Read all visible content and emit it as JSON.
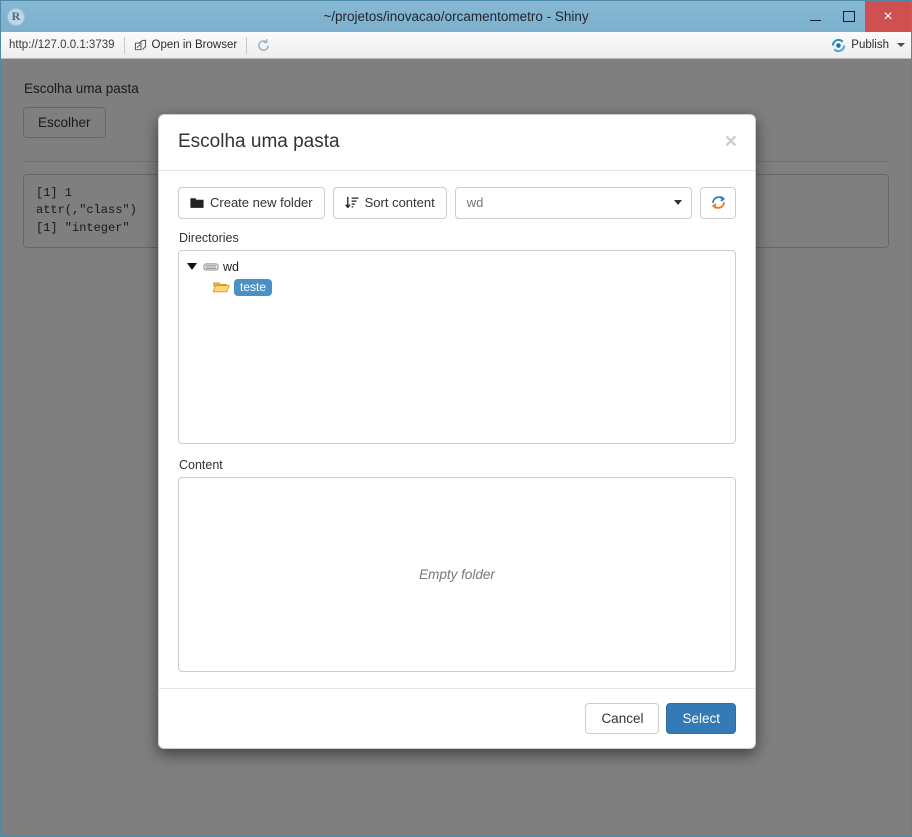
{
  "window": {
    "app_icon_letter": "R",
    "title": "~/projetos/inovacao/orcamentometro - Shiny",
    "minimize_label": "Minimize",
    "maximize_label": "Maximize",
    "close_label": "×"
  },
  "viewer_toolbar": {
    "url": "http://127.0.0.1:3739",
    "open_in_browser": "Open in Browser",
    "refresh_title": "Refresh",
    "publish": "Publish"
  },
  "app": {
    "field_label": "Escolha uma pasta",
    "choose_button": "Escolher",
    "code_output": "[1] 1\nattr(,\"class\")\n[1] \"integer\""
  },
  "modal": {
    "title": "Escolha uma pasta",
    "close": "×",
    "toolbar": {
      "create_folder": "Create new folder",
      "sort_content": "Sort content",
      "path_select_value": "wd",
      "refresh": "Refresh"
    },
    "directories": {
      "label": "Directories",
      "tree": [
        {
          "label": "wd",
          "icon": "drive-icon",
          "expanded": true,
          "selected": false
        },
        {
          "label": "teste",
          "icon": "folder-open-icon",
          "expanded": false,
          "selected": true
        }
      ]
    },
    "content": {
      "label": "Content",
      "empty_message": "Empty folder"
    },
    "footer": {
      "cancel": "Cancel",
      "select": "Select"
    }
  },
  "colors": {
    "titlebar": "#7cb0cd",
    "close_button": "#cf5050",
    "primary": "#337ab7",
    "selection": "#4a90c4",
    "folder_yellow": "#f5c45e",
    "backdrop": "rgba(0,0,0,0.5)"
  }
}
